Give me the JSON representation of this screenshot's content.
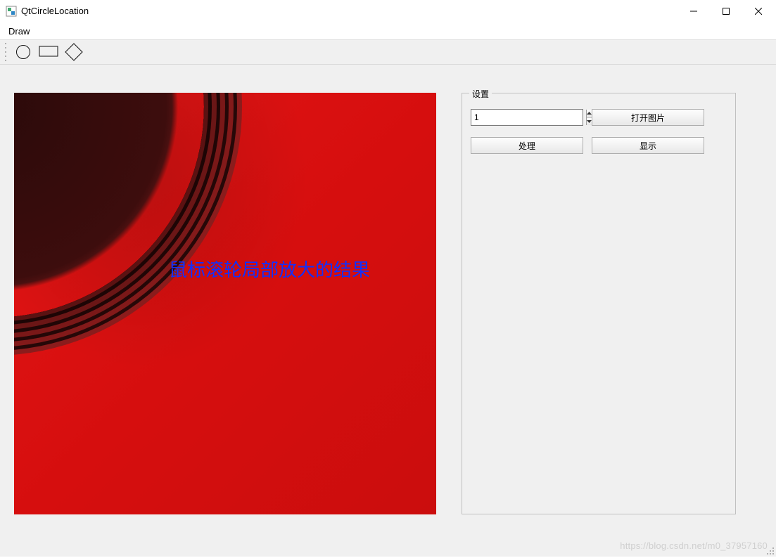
{
  "window": {
    "title": "QtCircleLocation"
  },
  "menu": {
    "draw": "Draw"
  },
  "toolbar": {
    "tools": [
      "circle",
      "rectangle",
      "diamond"
    ]
  },
  "viewport": {
    "overlay_text": "鼠标滚轮局部放大的结果"
  },
  "settings": {
    "group_title": "设置",
    "spin_value": "1",
    "open_image_label": "打开图片",
    "process_label": "处理",
    "display_label": "显示"
  },
  "watermark": "https://blog.csdn.net/m0_37957160"
}
